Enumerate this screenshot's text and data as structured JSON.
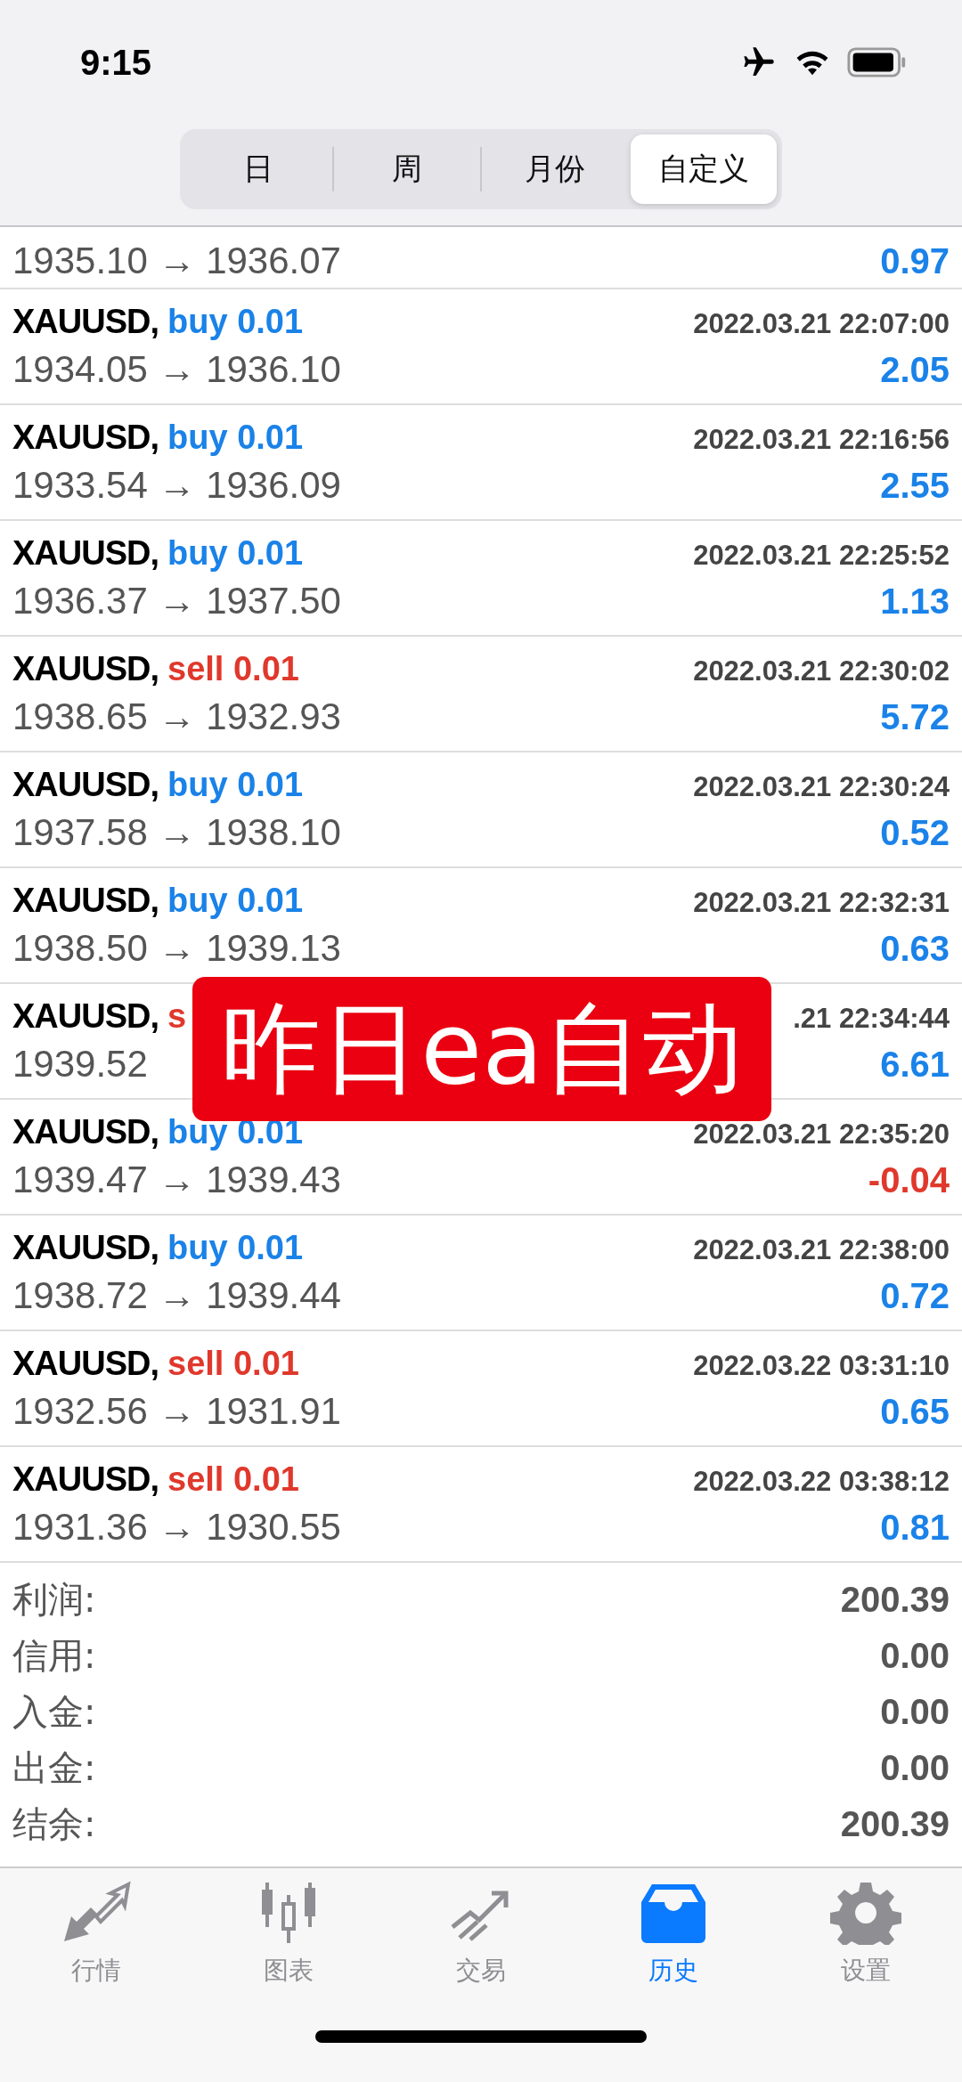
{
  "status_bar": {
    "time": "9:15"
  },
  "segments": [
    {
      "label": "日",
      "selected": false
    },
    {
      "label": "周",
      "selected": false
    },
    {
      "label": "月份",
      "selected": false
    },
    {
      "label": "自定义",
      "selected": true
    }
  ],
  "partial_row": {
    "prices": "1935.10 → 1936.07",
    "profit": "0.97",
    "negative": false
  },
  "deals": [
    {
      "symbol": "XAUUSD,",
      "sell": false,
      "order": "buy 0.01",
      "time": "2022.03.21 22:07:00",
      "prices": "1934.05 → 1936.10",
      "profit": "2.05",
      "negative": false
    },
    {
      "symbol": "XAUUSD,",
      "sell": false,
      "order": "buy 0.01",
      "time": "2022.03.21 22:16:56",
      "prices": "1933.54 → 1936.09",
      "profit": "2.55",
      "negative": false
    },
    {
      "symbol": "XAUUSD,",
      "sell": false,
      "order": "buy 0.01",
      "time": "2022.03.21 22:25:52",
      "prices": "1936.37 → 1937.50",
      "profit": "1.13",
      "negative": false
    },
    {
      "symbol": "XAUUSD,",
      "sell": true,
      "order": "sell 0.01",
      "time": "2022.03.21 22:30:02",
      "prices": "1938.65 → 1932.93",
      "profit": "5.72",
      "negative": false
    },
    {
      "symbol": "XAUUSD,",
      "sell": false,
      "order": "buy 0.01",
      "time": "2022.03.21 22:30:24",
      "prices": "1937.58 → 1938.10",
      "profit": "0.52",
      "negative": false
    },
    {
      "symbol": "XAUUSD,",
      "sell": false,
      "order": "buy 0.01",
      "time": "2022.03.21 22:32:31",
      "prices": "1938.50 → 1939.13",
      "profit": "0.63",
      "negative": false
    },
    {
      "symbol": "XAUUSD,",
      "sell": true,
      "order": "s",
      "time": ".21 22:34:44",
      "prices": "1939.52",
      "profit": "6.61",
      "negative": false
    },
    {
      "symbol": "XAUUSD,",
      "sell": false,
      "order": "buy 0.01",
      "time": "2022.03.21 22:35:20",
      "prices": "1939.47 → 1939.43",
      "profit": "-0.04",
      "negative": true
    },
    {
      "symbol": "XAUUSD,",
      "sell": false,
      "order": "buy 0.01",
      "time": "2022.03.21 22:38:00",
      "prices": "1938.72 → 1939.44",
      "profit": "0.72",
      "negative": false
    },
    {
      "symbol": "XAUUSD,",
      "sell": true,
      "order": "sell 0.01",
      "time": "2022.03.22 03:31:10",
      "prices": "1932.56 → 1931.91",
      "profit": "0.65",
      "negative": false
    },
    {
      "symbol": "XAUUSD,",
      "sell": true,
      "order": "sell 0.01",
      "time": "2022.03.22 03:38:12",
      "prices": "1931.36 → 1930.55",
      "profit": "0.81",
      "negative": false
    }
  ],
  "summary": [
    {
      "label": "利润:",
      "value": "200.39"
    },
    {
      "label": "信用:",
      "value": "0.00"
    },
    {
      "label": "入金:",
      "value": "0.00"
    },
    {
      "label": "出金:",
      "value": "0.00"
    },
    {
      "label": "结余:",
      "value": "200.39"
    }
  ],
  "overlay": {
    "text": "昨日ea自动"
  },
  "tab_bar": [
    {
      "kind": "quotes",
      "label": "行情",
      "selected": false
    },
    {
      "kind": "chart",
      "label": "图表",
      "selected": false
    },
    {
      "kind": "trade",
      "label": "交易",
      "selected": false
    },
    {
      "kind": "history",
      "label": "历史",
      "selected": true
    },
    {
      "kind": "settings",
      "label": "设置",
      "selected": false
    }
  ]
}
